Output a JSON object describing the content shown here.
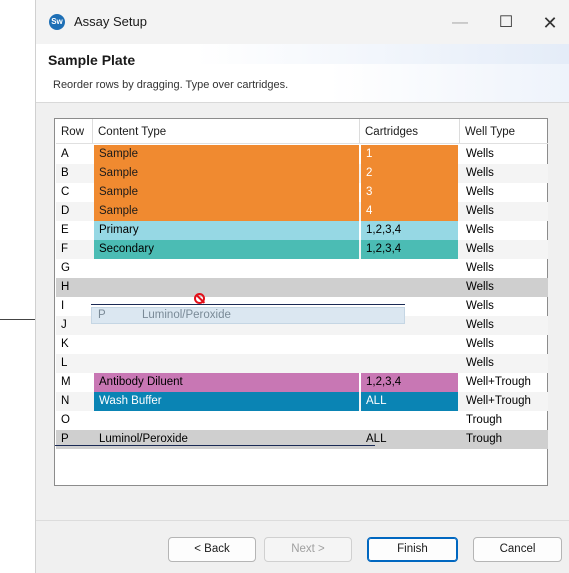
{
  "window": {
    "title": "Assay Setup",
    "icon_letters": "Sw"
  },
  "header": {
    "title": "Sample Plate",
    "subtitle": "Reorder rows by dragging. Type over cartridges."
  },
  "table": {
    "columns": [
      "Row",
      "Content Type",
      "Cartridges",
      "Well Type"
    ],
    "rows": [
      {
        "row": "A",
        "content": "Sample",
        "cartridges": "1",
        "well": "Wells",
        "color": "#f08a30"
      },
      {
        "row": "B",
        "content": "Sample",
        "cartridges": "2",
        "well": "Wells",
        "color": "#f08a30"
      },
      {
        "row": "C",
        "content": "Sample",
        "cartridges": "3",
        "well": "Wells",
        "color": "#f08a30"
      },
      {
        "row": "D",
        "content": "Sample",
        "cartridges": "4",
        "well": "Wells",
        "color": "#f08a30"
      },
      {
        "row": "E",
        "content": "Primary",
        "cartridges": "1,2,3,4",
        "well": "Wells",
        "color": "#96d8e4"
      },
      {
        "row": "F",
        "content": "Secondary",
        "cartridges": "1,2,3,4",
        "well": "Wells",
        "color": "#4bbcb4"
      },
      {
        "row": "G",
        "content": "",
        "cartridges": "",
        "well": "Wells",
        "color": ""
      },
      {
        "row": "H",
        "content": "",
        "cartridges": "",
        "well": "Wells",
        "color": ""
      },
      {
        "row": "I",
        "content": "",
        "cartridges": "",
        "well": "Wells",
        "color": ""
      },
      {
        "row": "J",
        "content": "",
        "cartridges": "",
        "well": "Wells",
        "color": ""
      },
      {
        "row": "K",
        "content": "",
        "cartridges": "",
        "well": "Wells",
        "color": ""
      },
      {
        "row": "L",
        "content": "",
        "cartridges": "",
        "well": "Wells",
        "color": ""
      },
      {
        "row": "M",
        "content": "Antibody Diluent",
        "cartridges": "1,2,3,4",
        "well": "Well+Trough",
        "color": "#c877b4"
      },
      {
        "row": "N",
        "content": "Wash Buffer",
        "cartridges": "ALL",
        "well": "Well+Trough",
        "color": "#0a84b4"
      },
      {
        "row": "O",
        "content": "",
        "cartridges": "",
        "well": "Trough",
        "color": ""
      },
      {
        "row": "P",
        "content": "Luminol/Peroxide",
        "cartridges": "ALL",
        "well": "Trough",
        "color": "#c8c8c8"
      }
    ],
    "drag_ghost": {
      "row": "P",
      "content": "Luminol/Peroxide"
    }
  },
  "buttons": {
    "back": "< Back",
    "next": "Next >",
    "finish": "Finish",
    "cancel": "Cancel"
  }
}
